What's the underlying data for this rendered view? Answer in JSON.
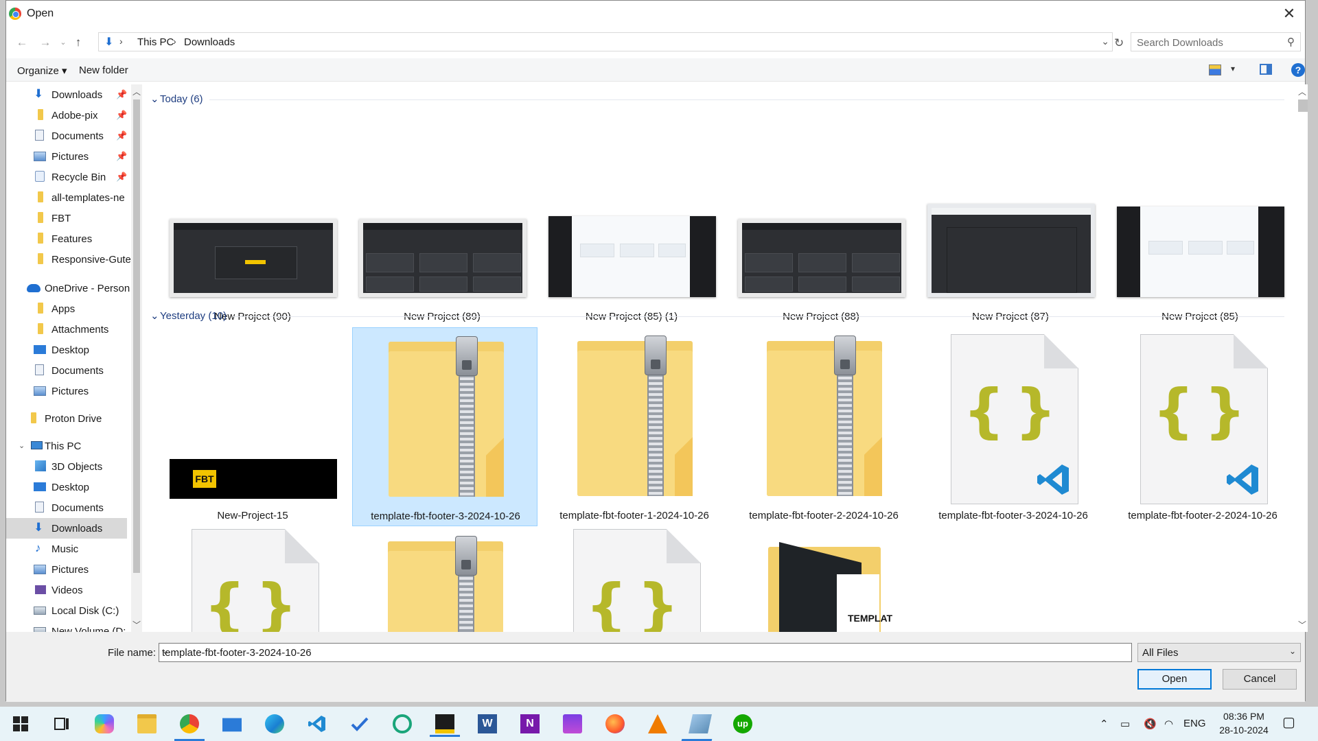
{
  "window": {
    "title": "Open"
  },
  "nav": {
    "breadcrumb": [
      "This PC",
      "Downloads"
    ],
    "search_placeholder": "Search Downloads"
  },
  "toolbar": {
    "organize": "Organize ▾",
    "new_folder": "New folder"
  },
  "sidebar": {
    "quick_access": [
      "Downloads",
      "Adobe-pix",
      "Documents",
      "Pictures",
      "Recycle Bin",
      "all-templates-ne",
      "FBT",
      "Features",
      "Responsive-Gute"
    ],
    "onedrive": {
      "label": "OneDrive - Person",
      "children": [
        "Apps",
        "Attachments",
        "Desktop",
        "Documents",
        "Pictures"
      ]
    },
    "proton": "Proton Drive",
    "this_pc": {
      "label": "This PC",
      "children": [
        "3D Objects",
        "Desktop",
        "Documents",
        "Downloads",
        "Music",
        "Pictures",
        "Videos",
        "Local Disk (C:)",
        "New Volume (D:"
      ]
    }
  },
  "groups": {
    "today": "Today (6)",
    "yesterday": "Yesterday (10)"
  },
  "today_items": [
    "New Project (90)",
    "New Project (89)",
    "New Project (85) (1)",
    "New Project (88)",
    "New Project (87)",
    "New Project (85)"
  ],
  "yesterday_items": [
    "New-Project-15",
    "template-fbt-footer-3-2024-10-26",
    "template-fbt-footer-1-2024-10-26",
    "template-fbt-footer-2-2024-10-26",
    "template-fbt-footer-3-2024-10-26",
    "template-fbt-footer-2-2024-10-26"
  ],
  "thumb_text": {
    "fbt": "FBT",
    "templat": "TEMPLAT"
  },
  "footer": {
    "file_name_label": "File name:",
    "file_name_value": "template-fbt-footer-3-2024-10-26",
    "file_type": "All Files",
    "open": "Open",
    "cancel": "Cancel"
  },
  "taskbar": {
    "lang": "ENG",
    "time": "08:36 PM",
    "date": "28-10-2024"
  },
  "colors": {
    "accent": "#0078d7",
    "selection": "#cce8ff",
    "taskbar": "#e8f3f8"
  }
}
